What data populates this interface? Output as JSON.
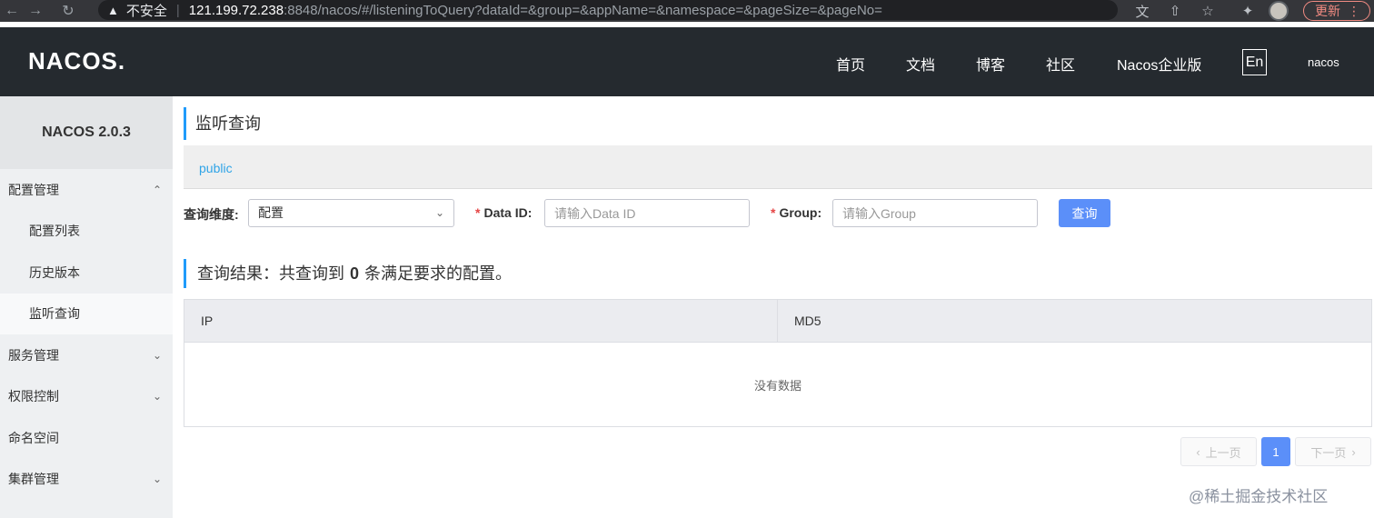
{
  "browser": {
    "insecure_label": "不安全",
    "url_host": "121.199.72.238",
    "url_rest": ":8848/nacos/#/listeningToQuery?dataId=&group=&appName=&namespace=&pageSize=&pageNo=",
    "update_label": "更新"
  },
  "header": {
    "logo": "NACOS.",
    "nav": [
      "首页",
      "文档",
      "博客",
      "社区",
      "Nacos企业版"
    ],
    "lang": "En",
    "user": "nacos"
  },
  "sidebar": {
    "version": "NACOS 2.0.3",
    "items": [
      {
        "label": "配置管理",
        "level": "top",
        "expanded": true
      },
      {
        "label": "配置列表",
        "level": "sub"
      },
      {
        "label": "历史版本",
        "level": "sub"
      },
      {
        "label": "监听查询",
        "level": "sub",
        "active": true
      },
      {
        "label": "服务管理",
        "level": "top",
        "expanded": false
      },
      {
        "label": "权限控制",
        "level": "top",
        "expanded": false
      },
      {
        "label": "命名空间",
        "level": "top"
      },
      {
        "label": "集群管理",
        "level": "top",
        "expanded": false
      }
    ]
  },
  "main": {
    "title": "监听查询",
    "namespace": "public",
    "form": {
      "dimension_label": "查询维度:",
      "dimension_value": "配置",
      "dataid_label": "Data ID:",
      "dataid_placeholder": "请输入Data ID",
      "group_label": "Group:",
      "group_placeholder": "请输入Group",
      "required_mark": "*",
      "query_button": "查询"
    },
    "result": {
      "prefix": "查询结果：共查询到",
      "count": "0",
      "suffix": "条满足要求的配置。"
    },
    "table": {
      "columns": [
        "IP",
        "MD5"
      ],
      "empty_text": "没有数据"
    },
    "pagination": {
      "prev": "上一页",
      "current": "1",
      "next": "下一页"
    }
  },
  "watermark": "@稀土掘金技术社区",
  "colors": {
    "header_bg": "#252a2f",
    "accent": "#5b8ff9",
    "link": "#2fa4e7",
    "title_bar": "#209bfa"
  }
}
